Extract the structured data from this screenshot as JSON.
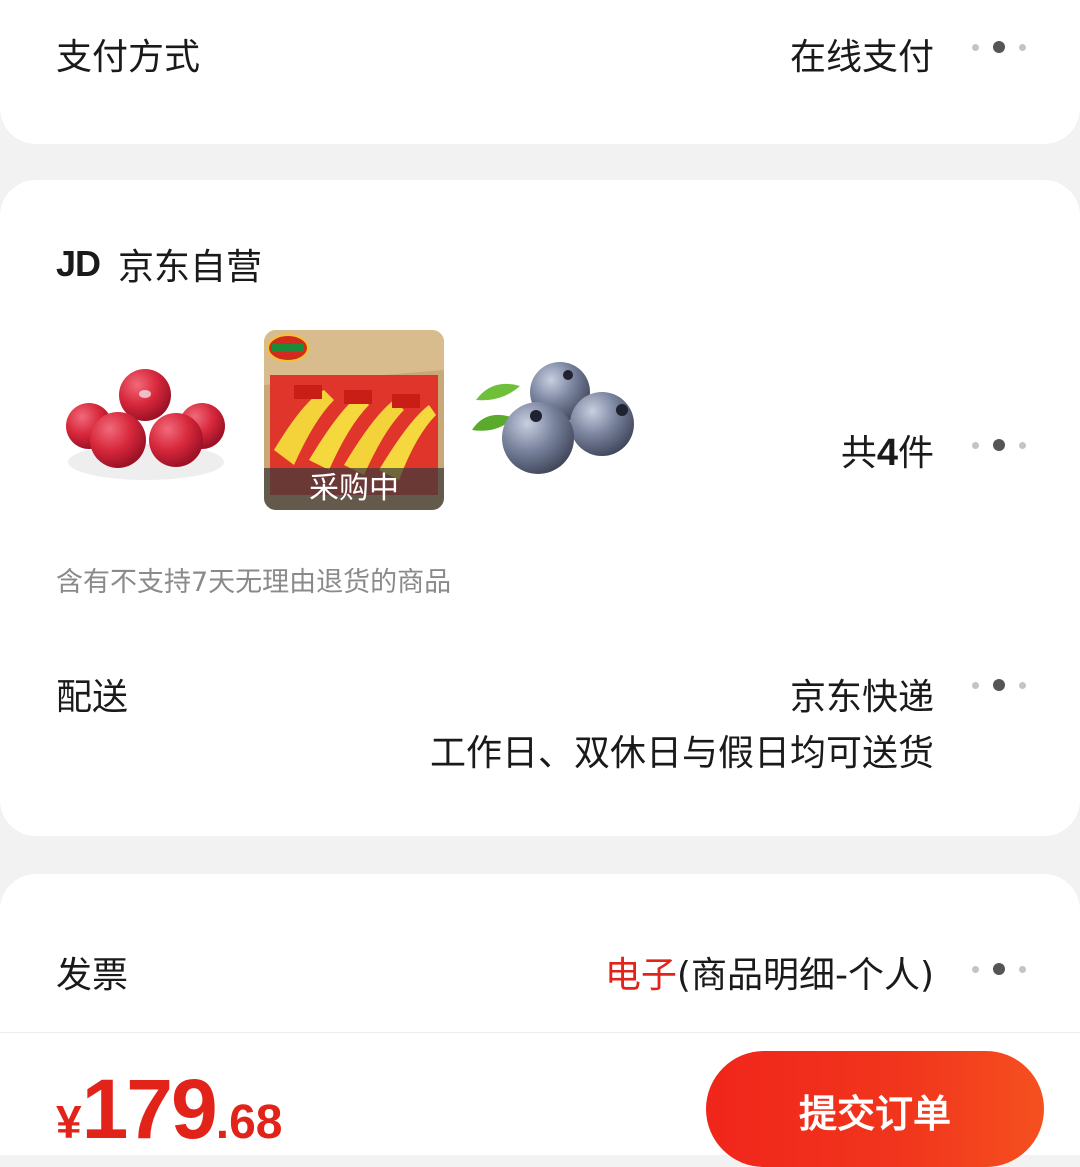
{
  "payment": {
    "label": "支付方式",
    "value": "在线支付"
  },
  "shop": {
    "logo": "JD",
    "name": "京东自营",
    "products": [
      {
        "icon": "apple-image"
      },
      {
        "icon": "banana-image",
        "status": "采购中"
      },
      {
        "icon": "blueberry-image"
      }
    ],
    "count_prefix": "共",
    "count_number": "4",
    "count_suffix": "件",
    "return_notice": "含有不支持7天无理由退货的商品",
    "delivery": {
      "label": "配送",
      "carrier": "京东快递",
      "schedule": "工作日、双休日与假日均可送货"
    }
  },
  "invoice": {
    "label": "发票",
    "type": "电子",
    "detail": "(商品明细-个人)"
  },
  "footer": {
    "currency": "¥",
    "price_int": "179",
    "price_dec": ".68",
    "submit_label": "提交订单"
  },
  "colors": {
    "accent": "#e2231a",
    "button_start": "#f1251b",
    "button_end": "#f5501f",
    "background": "#f2f2f2"
  }
}
